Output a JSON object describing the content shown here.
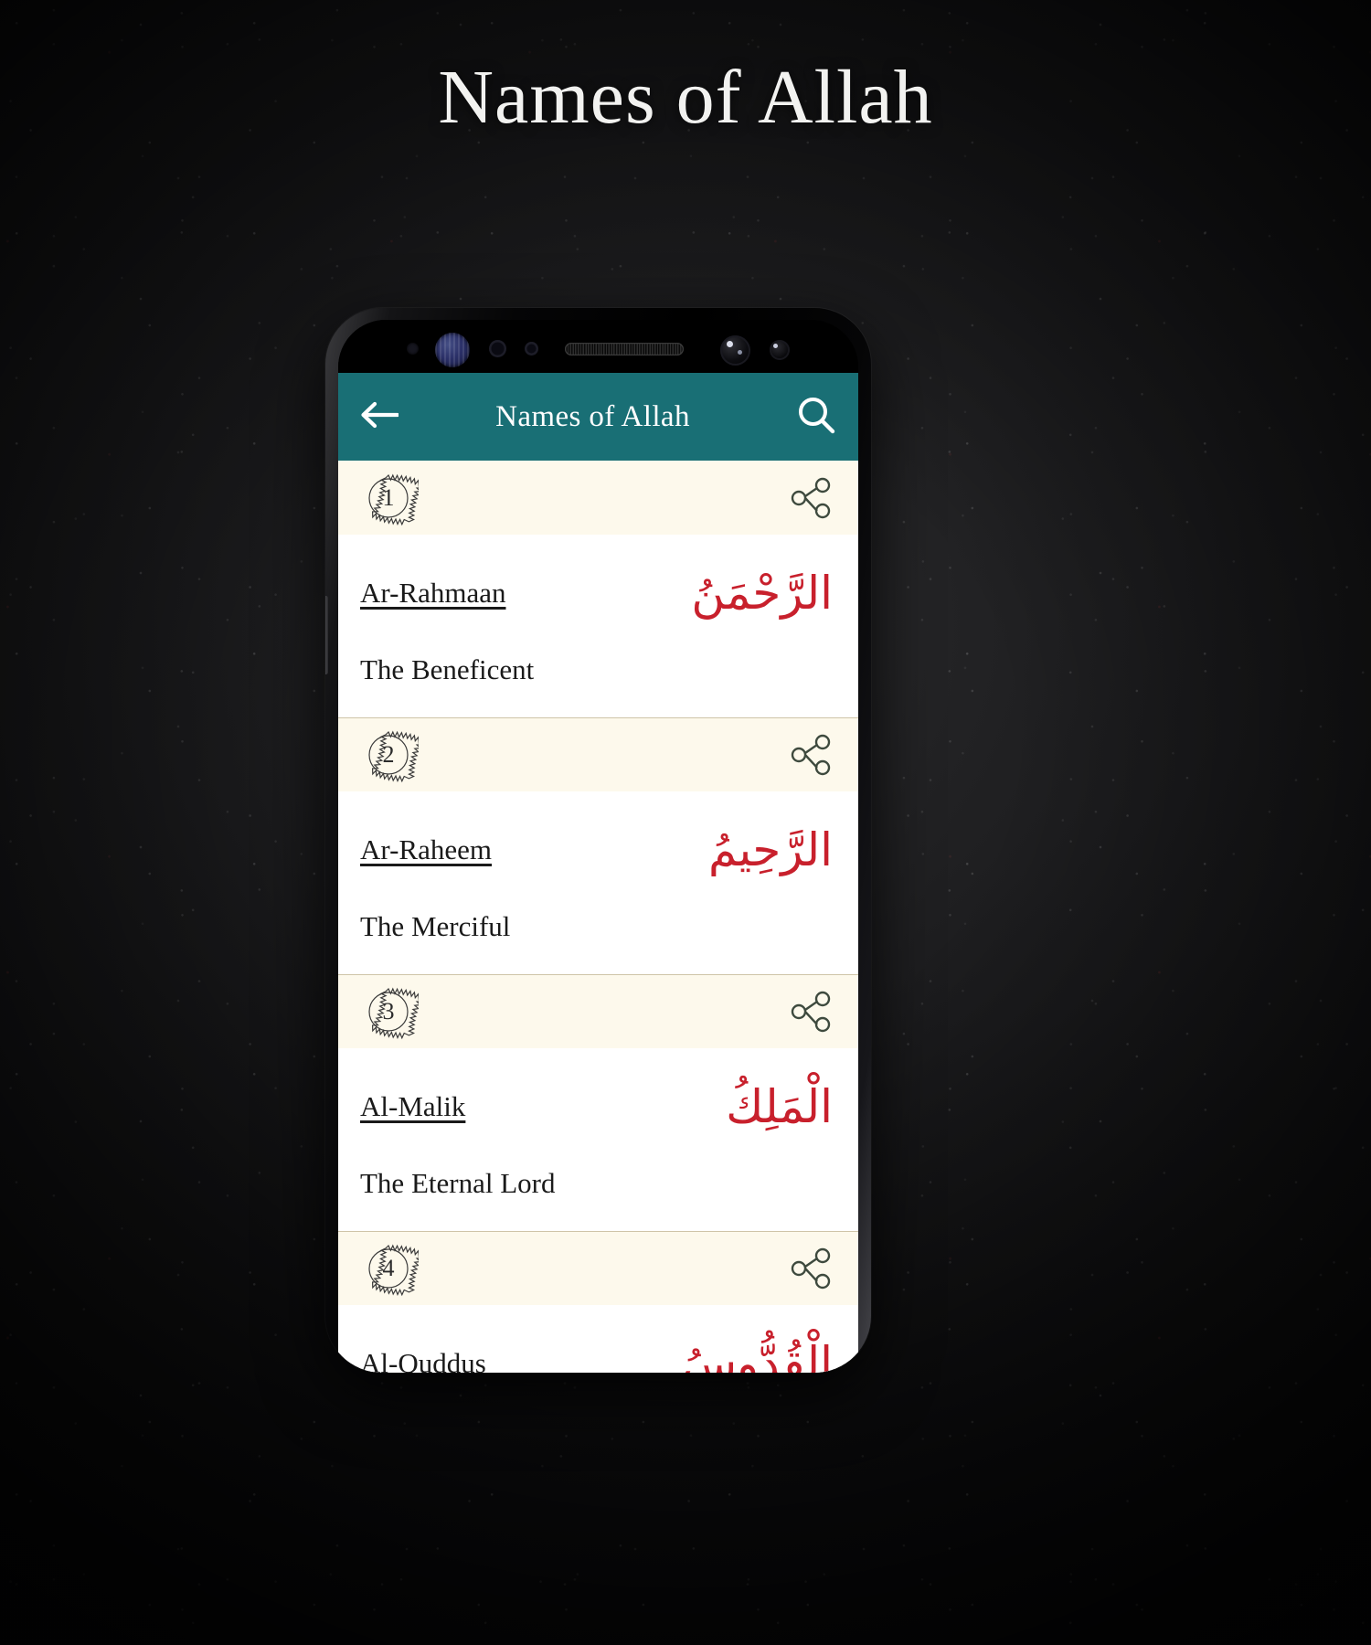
{
  "page": {
    "heading": "Names of Allah",
    "background_color": "#141415",
    "heading_color": "#f2f2f0"
  },
  "app": {
    "toolbar": {
      "title": "Names of Allah",
      "background_color": "#196f75",
      "title_color": "#ffffff",
      "back_icon": "back-arrow-icon",
      "search_icon": "search-icon"
    },
    "list": {
      "header_background": "#fdf9ec",
      "arabic_color": "#c8202c",
      "share_icon": "share-icon",
      "items": [
        {
          "number": "1",
          "transliteration": "Ar-Rahmaan",
          "arabic": "الرَّحْمَنُ",
          "meaning": "The Beneficent"
        },
        {
          "number": "2",
          "transliteration": "Ar-Raheem",
          "arabic": "الرَّحِيمُ",
          "meaning": "The Merciful"
        },
        {
          "number": "3",
          "transliteration": "Al-Malik",
          "arabic": "الْمَلِكُ",
          "meaning": "The Eternal Lord"
        },
        {
          "number": "4",
          "transliteration": "Al-Quddus",
          "arabic": "الْقُدُّوسُ",
          "meaning": ""
        }
      ]
    }
  },
  "device": {
    "sensors": [
      "proximity-sensor-icon",
      "iris-scanner-icon",
      "light-sensor-icon",
      "ir-sensor-icon",
      "earpiece-speaker-icon",
      "front-camera-icon",
      "flood-illuminator-icon"
    ]
  }
}
